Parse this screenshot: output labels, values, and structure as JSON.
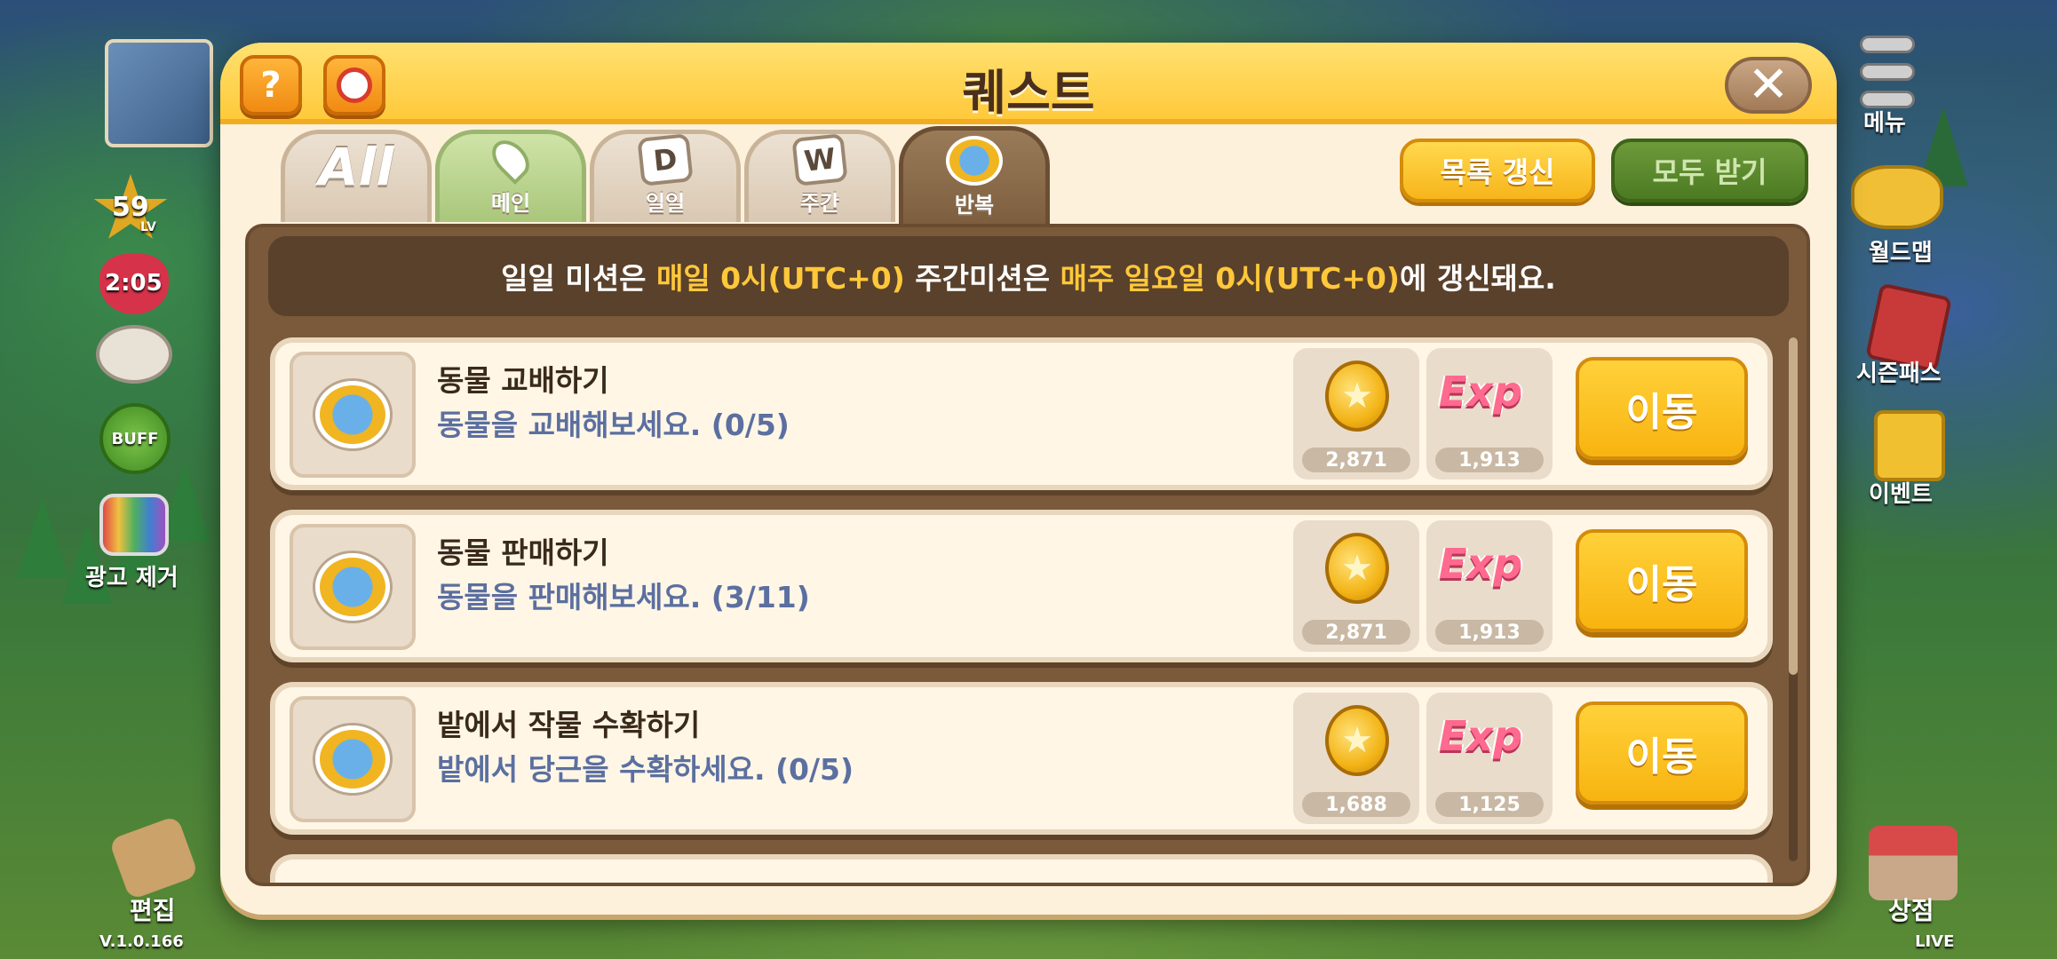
{
  "modal": {
    "title": "퀘스트",
    "help_label": "?",
    "close_label": "✕"
  },
  "tabs": [
    {
      "label": "",
      "glyph": "All"
    },
    {
      "label": "메인",
      "glyph": ""
    },
    {
      "label": "일일",
      "glyph": "D"
    },
    {
      "label": "주간",
      "glyph": "W"
    },
    {
      "label": "반복",
      "glyph": ""
    }
  ],
  "actions": {
    "refresh_label": "목록 갱신",
    "claim_all_label": "모두 받기"
  },
  "notice": {
    "p1": "일일 미션은 ",
    "h1": "매일 0시(UTC+0)",
    "p2": " 주간미션은 ",
    "h2": "매주 일요일 0시(UTC+0)",
    "p3": "에 갱신돼요."
  },
  "quests": [
    {
      "title": "동물 교배하기",
      "desc": "동물을 교배해보세요. (0/5)",
      "coin": "2,871",
      "exp": "1,913",
      "exp_label": "Exp",
      "button": "이동"
    },
    {
      "title": "동물 판매하기",
      "desc": "동물을 판매해보세요. (3/11)",
      "coin": "2,871",
      "exp": "1,913",
      "exp_label": "Exp",
      "button": "이동"
    },
    {
      "title": "밭에서 작물 수확하기",
      "desc": "밭에서 당근을 수확하세요. (0/5)",
      "coin": "1,688",
      "exp": "1,125",
      "exp_label": "Exp",
      "button": "이동"
    }
  ],
  "hud": {
    "level": "59",
    "level_suffix": "LV",
    "heart_timer": "2:05",
    "buff_label": "BUFF",
    "ad_remove_label": "광고 제거",
    "edit_label": "편집",
    "version": "V.1.0.166",
    "menu_label": "메뉴",
    "world_map_label": "월드맵",
    "season_pass_label": "시즌패스",
    "event_label": "이벤트",
    "shop_label": "상점",
    "live_label": "LIVE"
  },
  "colors": {
    "header": "#ffc93b",
    "highlight": "#ffc83a",
    "panel": "#7a5a3b",
    "button_yellow": "#f8b410",
    "button_green": "#4c7a22"
  }
}
